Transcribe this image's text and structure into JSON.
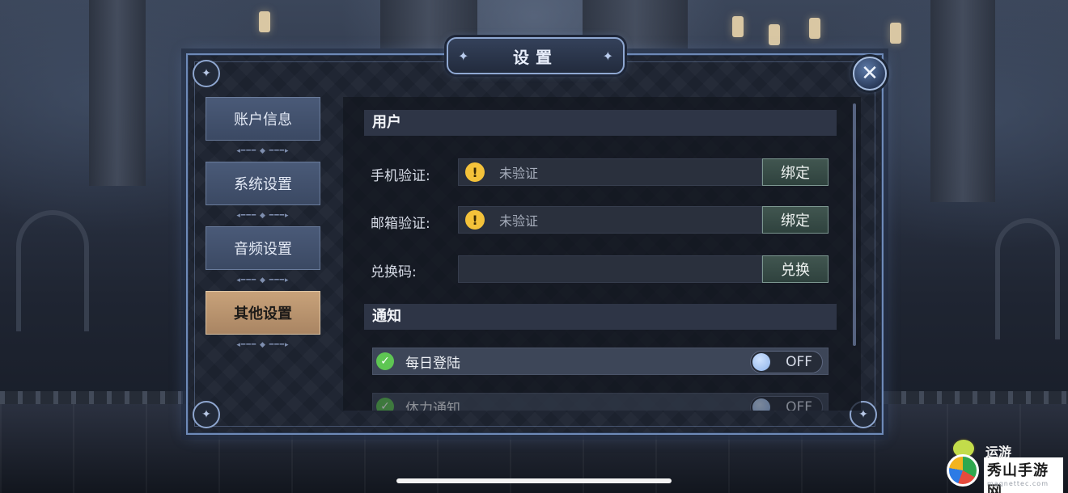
{
  "dialog": {
    "title": "设置",
    "close_icon": "close-icon",
    "corner_icon": "diamond-ornament-icon"
  },
  "nav": {
    "items": [
      {
        "label": "账户信息",
        "active": false
      },
      {
        "label": "系统设置",
        "active": false
      },
      {
        "label": "音频设置",
        "active": false
      },
      {
        "label": "其他设置",
        "active": true
      }
    ],
    "divider": "◂━━━ ◆ ━━━▸"
  },
  "user_section": {
    "heading": "用户",
    "phone": {
      "label": "手机验证:",
      "status_icon": "warning-icon",
      "status": "未验证",
      "button": "绑定"
    },
    "email": {
      "label": "邮箱验证:",
      "status_icon": "warning-icon",
      "status": "未验证",
      "button": "绑定"
    },
    "redeem": {
      "label": "兑换码:",
      "value": "",
      "button": "兑换"
    }
  },
  "notify_section": {
    "heading": "通知",
    "items": [
      {
        "label": "每日登陆",
        "state": "OFF",
        "check_icon": "check-icon"
      },
      {
        "label": "体力通知",
        "state": "OFF",
        "check_icon": "check-icon"
      }
    ]
  },
  "watermark": {
    "top": "运游",
    "name": "秀山手游网",
    "url": "magnettec.com"
  },
  "colors": {
    "active_tab": "#c8a27a",
    "nav_tab": "#4a5a78",
    "warning": "#f4c23a",
    "check": "#5ec653",
    "frame": "#6e8ab8"
  }
}
